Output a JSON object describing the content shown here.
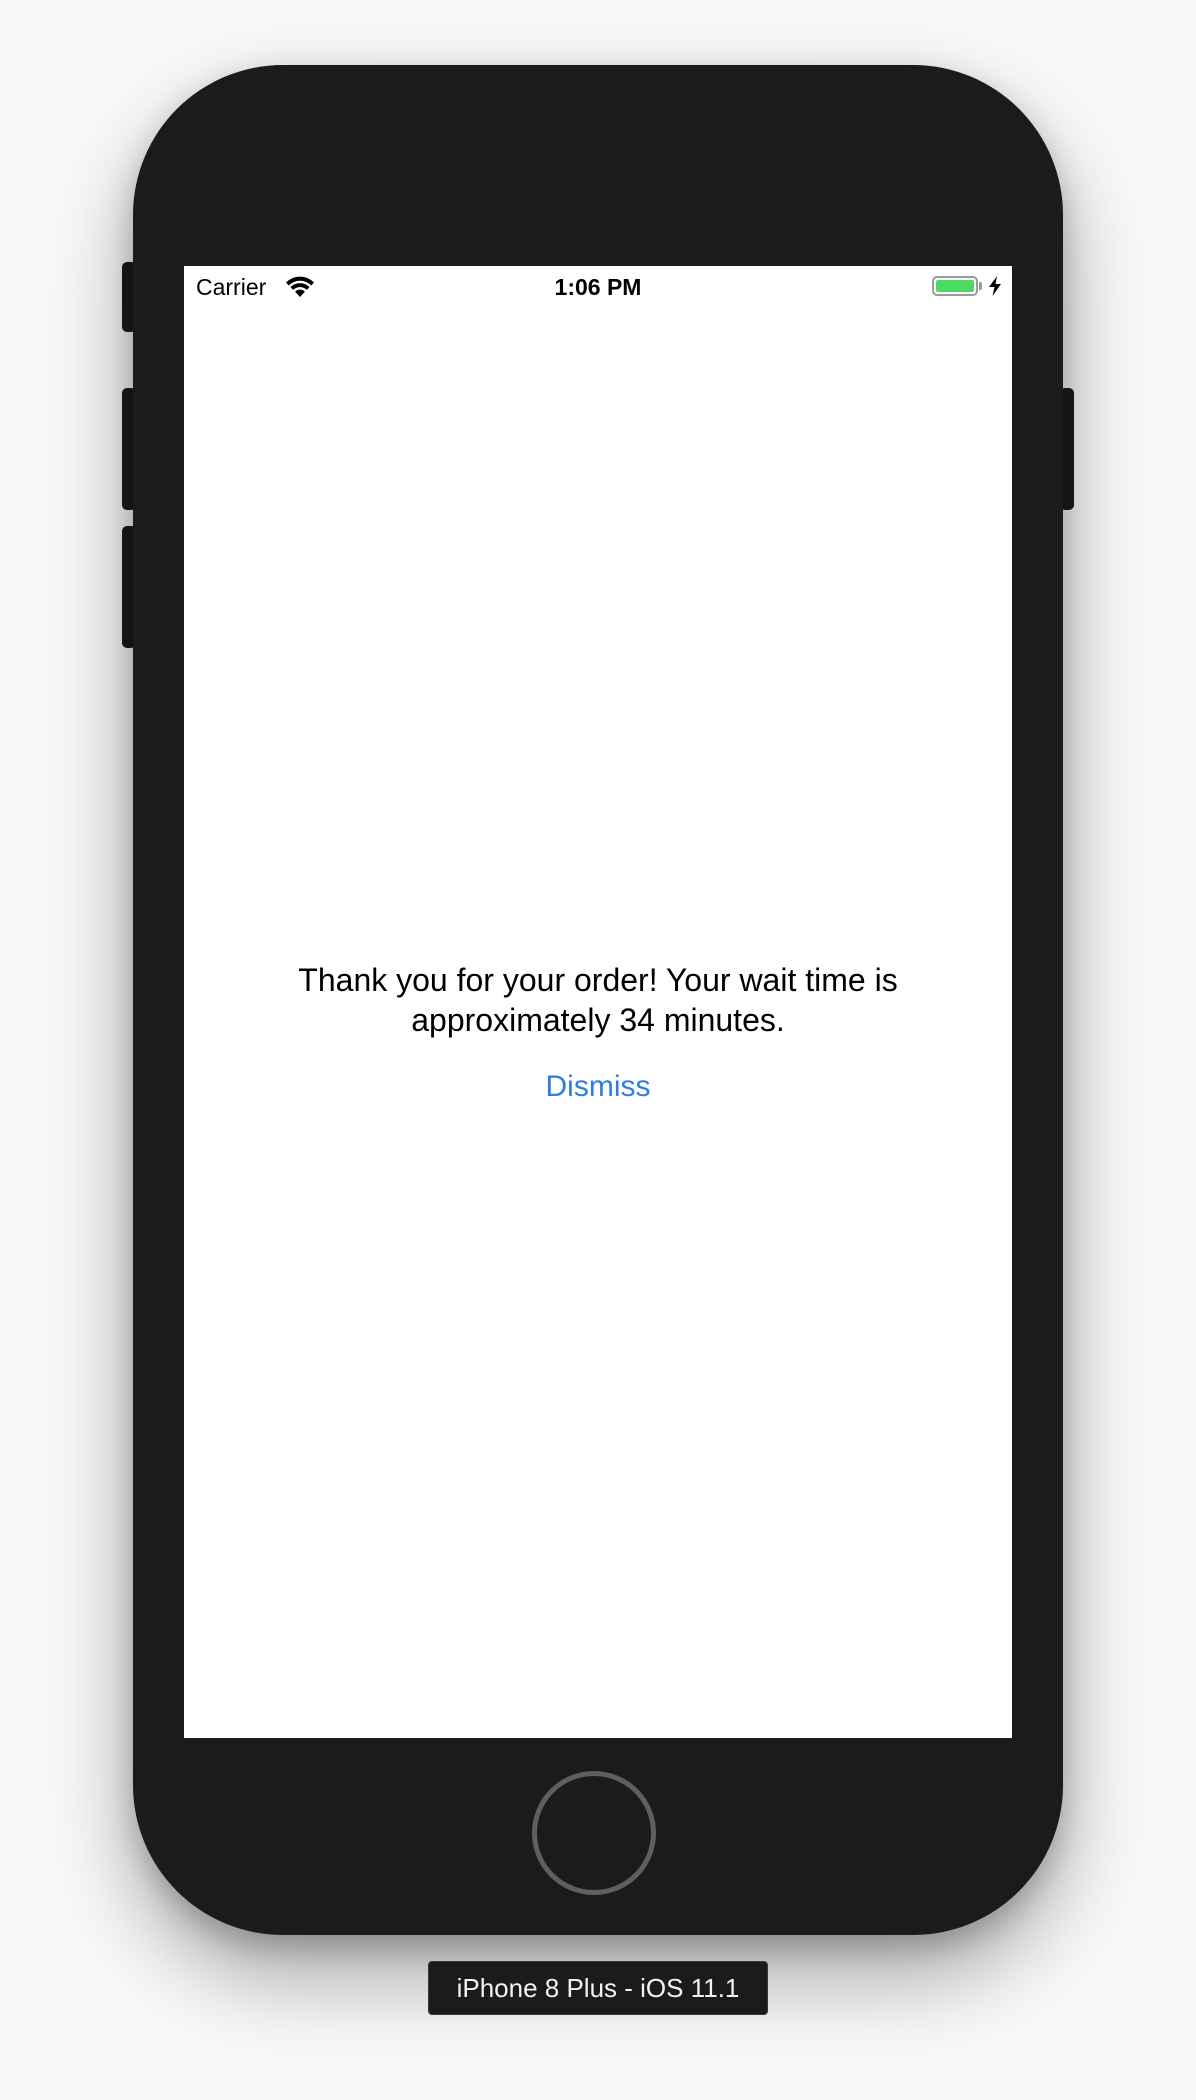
{
  "status_bar": {
    "carrier": "Carrier",
    "time": "1:06 PM",
    "wifi_icon": "wifi-icon",
    "battery_icon": "battery-icon",
    "charging_icon": "charging-bolt-icon",
    "battery_color": "#4cd964"
  },
  "content": {
    "message_line1": "Thank you for your order! Your wait time is",
    "message_line2": "approximately 34 minutes.",
    "dismiss_label": "Dismiss",
    "accent_color": "#2f7ddf"
  },
  "simulator": {
    "device_label": "iPhone 8 Plus - iOS 11.1",
    "home_button_icon": "home-button-icon"
  }
}
